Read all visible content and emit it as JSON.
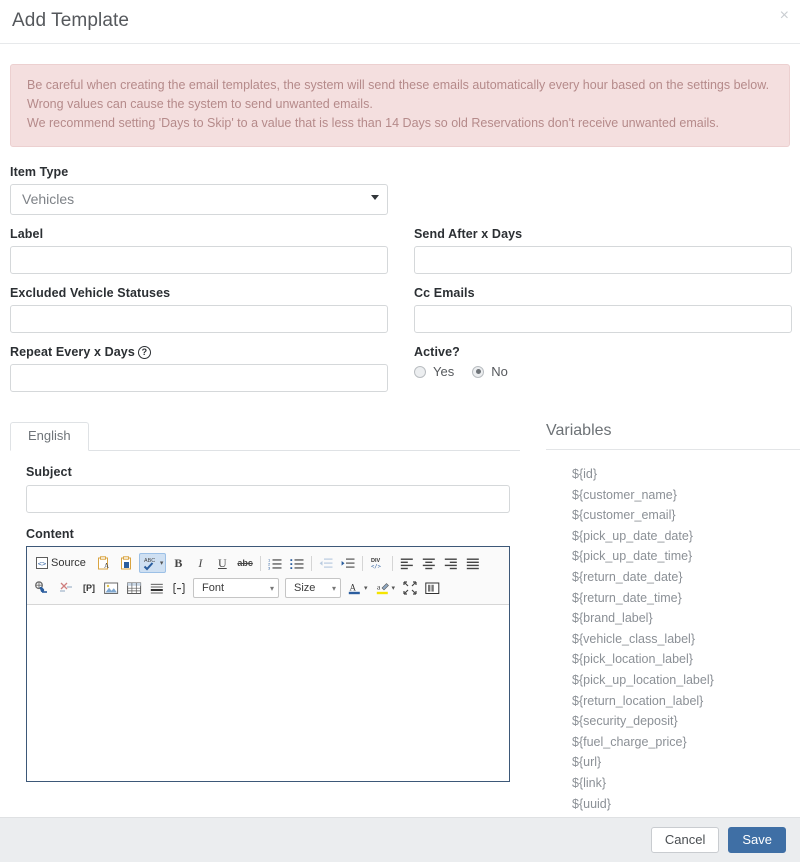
{
  "header": {
    "title": "Add Template",
    "close_label": "×"
  },
  "alert": {
    "line1": "Be careful when creating the email templates, the system will send these emails automatically every hour based on the settings below.",
    "line2": "Wrong values can cause the system to send unwanted emails.",
    "line3": "We recommend setting 'Days to Skip' to a value that is less than 14 Days so old Reservations don't receive unwanted emails."
  },
  "form": {
    "item_type": {
      "label": "Item Type",
      "value": "Vehicles"
    },
    "label_field": {
      "label": "Label",
      "value": ""
    },
    "send_after": {
      "label": "Send After x Days",
      "value": ""
    },
    "excluded_statuses": {
      "label": "Excluded Vehicle Statuses",
      "value": ""
    },
    "cc_emails": {
      "label": "Cc Emails",
      "value": ""
    },
    "repeat_every": {
      "label": "Repeat Every x Days",
      "help_icon": "?",
      "value": ""
    },
    "active": {
      "label": "Active?",
      "options": [
        "Yes",
        "No"
      ],
      "selected": "No"
    }
  },
  "tabs": [
    {
      "label": "English",
      "active": true
    }
  ],
  "content_section": {
    "subject": {
      "label": "Subject",
      "value": ""
    },
    "content": {
      "label": "Content",
      "value": ""
    }
  },
  "editor": {
    "source_label": "Source",
    "font_label": "Font",
    "size_label": "Size",
    "row1": [
      {
        "name": "source-button",
        "label": "Source"
      },
      {
        "name": "paste-text-icon"
      },
      {
        "name": "paste-from-word-icon"
      },
      {
        "name": "spell-check-icon",
        "active": true
      },
      {
        "name": "bold-icon",
        "label": "B"
      },
      {
        "name": "italic-icon",
        "label": "I"
      },
      {
        "name": "underline-icon",
        "label": "U"
      },
      {
        "name": "strikethrough-icon",
        "label": "abc"
      },
      {
        "name": "numbered-list-icon"
      },
      {
        "name": "bulleted-list-icon"
      },
      {
        "name": "decrease-indent-icon"
      },
      {
        "name": "increase-indent-icon"
      },
      {
        "name": "create-div-icon"
      },
      {
        "name": "align-left-icon"
      },
      {
        "name": "align-center-icon"
      },
      {
        "name": "align-right-icon"
      },
      {
        "name": "justify-icon"
      }
    ],
    "row2": [
      {
        "name": "link-icon"
      },
      {
        "name": "unlink-icon"
      },
      {
        "name": "page-break-icon",
        "label": "[P]"
      },
      {
        "name": "image-icon"
      },
      {
        "name": "table-icon"
      },
      {
        "name": "horizontal-rule-icon"
      },
      {
        "name": "special-character-icon"
      },
      {
        "name": "font-family-combo",
        "label": "Font"
      },
      {
        "name": "font-size-combo",
        "label": "Size"
      },
      {
        "name": "text-color-icon",
        "label": "A"
      },
      {
        "name": "background-color-icon"
      },
      {
        "name": "maximize-icon"
      },
      {
        "name": "show-blocks-icon"
      }
    ]
  },
  "variables": {
    "title": "Variables",
    "items": [
      "${id}",
      "${customer_name}",
      "${customer_email}",
      "${pick_up_date_date}",
      "${pick_up_date_time}",
      "${return_date_date}",
      "${return_date_time}",
      "${brand_label}",
      "${vehicle_class_label}",
      "${pick_location_label}",
      "${pick_up_location_label}",
      "${return_location_label}",
      "${security_deposit}",
      "${fuel_charge_price}",
      "${url}",
      "${link}",
      "${uuid}"
    ]
  },
  "footer": {
    "cancel_label": "Cancel",
    "save_label": "Save"
  },
  "colors": {
    "accent": "#3f6fa5",
    "alert_bg": "#f4dfdf",
    "alert_border": "#ecd0d0",
    "alert_text": "#b58a8a",
    "editor_border": "#3d5878",
    "footer_bg": "#ebedef"
  }
}
